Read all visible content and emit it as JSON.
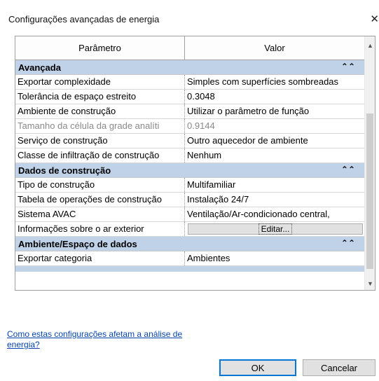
{
  "dialog": {
    "title": "Configurações avançadas de energia",
    "close_label": "✕"
  },
  "grid": {
    "headers": [
      "Parâmetro",
      "Valor"
    ],
    "groups": [
      {
        "name": "Avançada",
        "rows": [
          {
            "param": "Exportar complexidade",
            "value": "Simples com superfícies sombreadas",
            "disabled": false
          },
          {
            "param": "Tolerância de espaço estreito",
            "value": "0.3048",
            "disabled": false
          },
          {
            "param": "Ambiente de construção",
            "value": "Utilizar o parâmetro de função",
            "disabled": false
          },
          {
            "param": "Tamanho da célula da grade analíti",
            "value": "0.9144",
            "disabled": true
          },
          {
            "param": "Serviço de construção",
            "value": "Outro aquecedor de ambiente",
            "disabled": false
          },
          {
            "param": "Classe de infiltração de construção",
            "value": "Nenhum",
            "disabled": false
          }
        ]
      },
      {
        "name": "Dados de construção",
        "rows": [
          {
            "param": "Tipo de construção",
            "value": "Multifamiliar",
            "disabled": false
          },
          {
            "param": "Tabela de operações de construção",
            "value": "Instalação 24/7",
            "disabled": false
          },
          {
            "param": "Sistema AVAC",
            "value": "Ventilação/Ar-condicionado central,",
            "disabled": false
          },
          {
            "param": "Informações sobre o ar exterior",
            "value": "Editar...",
            "is_button": true
          }
        ]
      },
      {
        "name": "Ambiente/Espaço de dados",
        "rows": [
          {
            "param": "Exportar categoria",
            "value": "Ambientes",
            "disabled": false
          }
        ]
      }
    ]
  },
  "footer": {
    "help_link": "Como estas configurações afetam a análise de energia?",
    "ok_label": "OK",
    "cancel_label": "Cancelar"
  },
  "colors": {
    "group_header_bg": "#bfd2e8",
    "link": "#0645ad",
    "default_button_border": "#0078d7"
  }
}
